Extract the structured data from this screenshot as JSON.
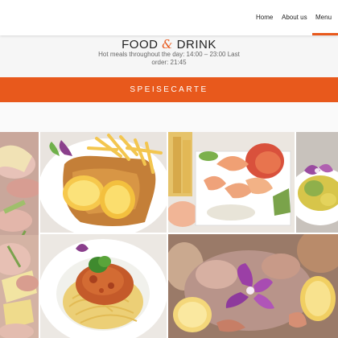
{
  "nav": {
    "items": [
      {
        "label": "Home"
      },
      {
        "label": "About us"
      },
      {
        "label": "Menu"
      }
    ],
    "accent_color": "#e8591c"
  },
  "intro": {
    "title_part1": "FOOD ",
    "title_amp": "&",
    "title_part2": " DRINK",
    "hours_line1": "Hot meals throughout the day: 14:00 – 23:00 Last",
    "hours_line2": "order: 21:45"
  },
  "banner": {
    "label": "SPEISECARTE",
    "color": "#e8591c"
  },
  "gallery": {
    "images": [
      {
        "subject": "cold-cuts-platter"
      },
      {
        "subject": "schnitzel-with-fries"
      },
      {
        "subject": "shrimp-platter"
      },
      {
        "subject": "salad-with-orchid"
      },
      {
        "subject": "cheese-and-ham-platter"
      },
      {
        "subject": "spaghetti-bolognese"
      },
      {
        "subject": "seafood-platter"
      }
    ]
  }
}
